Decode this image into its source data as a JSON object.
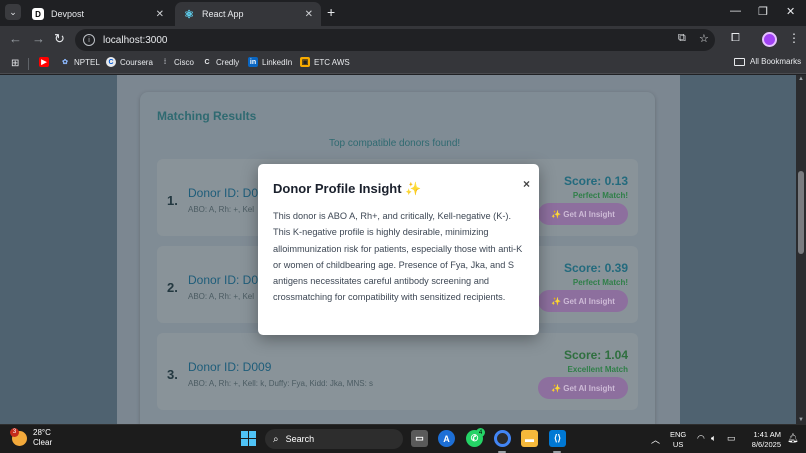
{
  "browser": {
    "tabs": [
      {
        "title": "Devpost",
        "favicon": "D",
        "active": false
      },
      {
        "title": "React App",
        "favicon": "⚛",
        "active": true
      }
    ],
    "url": "localhost:3000",
    "bookmarks": [
      "NPTEL",
      "Coursera",
      "Cisco",
      "Credly",
      "LinkedIn",
      "ETC AWS"
    ],
    "all_bookmarks_label": "All Bookmarks"
  },
  "page": {
    "results_title": "Matching Results",
    "results_subtitle": "Top compatible donors found!",
    "donors": [
      {
        "rank": "1.",
        "id": "Donor ID: D0",
        "attrs": "ABO: A, Rh: +, Kel",
        "score": "Score: 0.13",
        "match": "Perfect Match!",
        "button": "✨ Get AI Insight"
      },
      {
        "rank": "2.",
        "id": "Donor ID: D0",
        "attrs": "ABO: A, Rh: +, Kel",
        "score": "Score: 0.39",
        "match": "Perfect Match!",
        "button": "✨ Get AI Insight"
      },
      {
        "rank": "3.",
        "id": "Donor ID: D009",
        "attrs": "ABO: A, Rh: +, Kell: k, Duffy: Fya, Kidd: Jka, MNS: s",
        "score": "Score: 1.04",
        "match": "Excellent Match",
        "button": "✨ Get AI Insight"
      }
    ]
  },
  "modal": {
    "title": "Donor Profile Insight ✨",
    "close": "×",
    "body": "This donor is ABO A, Rh+, and critically, Kell-negative (K-). This K-negative profile is highly desirable, minimizing alloimmunization risk for patients, especially those with anti-K or women of childbearing age. Presence of Fya, Jka, and S antigens necessitates careful antibody screening and crossmatching for compatibility with sensitized recipients."
  },
  "taskbar": {
    "weather_temp": "28°C",
    "weather_desc": "Clear",
    "weather_badge": "3",
    "search_placeholder": "Search",
    "whatsapp_badge": "4",
    "lang_line1": "ENG",
    "lang_line2": "US",
    "time": "1:41 AM",
    "date": "8/6/2025"
  },
  "colors": {
    "accent_teal": "#2f6a71",
    "ai_button": "#8d6f9e",
    "modal_bg": "#ffffff"
  }
}
